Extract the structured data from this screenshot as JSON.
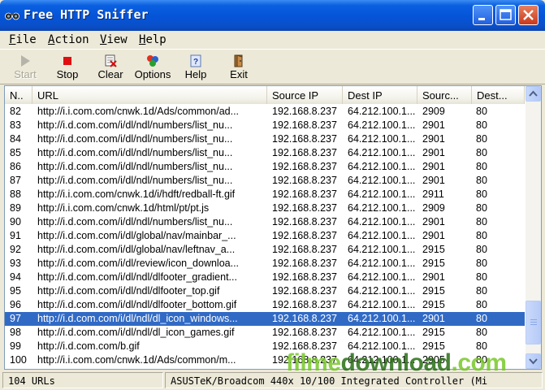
{
  "window": {
    "title": "Free HTTP Sniffer"
  },
  "menu": [
    {
      "accel": "F",
      "rest": "ile"
    },
    {
      "accel": "A",
      "rest": "ction"
    },
    {
      "accel": "V",
      "rest": "iew"
    },
    {
      "accel": "H",
      "rest": "elp"
    }
  ],
  "toolbar": {
    "start": "Start",
    "stop": "Stop",
    "clear": "Clear",
    "options": "Options",
    "help": "Help",
    "exit": "Exit"
  },
  "columns": [
    "N..",
    "URL",
    "Source IP",
    "Dest IP",
    "Sourc...",
    "Dest..."
  ],
  "rows": [
    [
      "82",
      "http://i.i.com.com/cnwk.1d/Ads/common/ad...",
      "192.168.8.237",
      "64.212.100.1...",
      "2909",
      "80"
    ],
    [
      "83",
      "http://i.d.com.com/i/dl/ndl/numbers/list_nu...",
      "192.168.8.237",
      "64.212.100.1...",
      "2901",
      "80"
    ],
    [
      "84",
      "http://i.d.com.com/i/dl/ndl/numbers/list_nu...",
      "192.168.8.237",
      "64.212.100.1...",
      "2901",
      "80"
    ],
    [
      "85",
      "http://i.d.com.com/i/dl/ndl/numbers/list_nu...",
      "192.168.8.237",
      "64.212.100.1...",
      "2901",
      "80"
    ],
    [
      "86",
      "http://i.d.com.com/i/dl/ndl/numbers/list_nu...",
      "192.168.8.237",
      "64.212.100.1...",
      "2901",
      "80"
    ],
    [
      "87",
      "http://i.d.com.com/i/dl/ndl/numbers/list_nu...",
      "192.168.8.237",
      "64.212.100.1...",
      "2901",
      "80"
    ],
    [
      "88",
      "http://i.i.com.com/cnwk.1d/i/hdft/redball-ft.gif",
      "192.168.8.237",
      "64.212.100.1...",
      "2911",
      "80"
    ],
    [
      "89",
      "http://i.i.com.com/cnwk.1d/html/pt/pt.js",
      "192.168.8.237",
      "64.212.100.1...",
      "2909",
      "80"
    ],
    [
      "90",
      "http://i.d.com.com/i/dl/ndl/numbers/list_nu...",
      "192.168.8.237",
      "64.212.100.1...",
      "2901",
      "80"
    ],
    [
      "91",
      "http://i.d.com.com/i/dl/global/nav/mainbar_...",
      "192.168.8.237",
      "64.212.100.1...",
      "2901",
      "80"
    ],
    [
      "92",
      "http://i.d.com.com/i/dl/global/nav/leftnav_a...",
      "192.168.8.237",
      "64.212.100.1...",
      "2915",
      "80"
    ],
    [
      "93",
      "http://i.d.com.com/i/dl/review/icon_downloa...",
      "192.168.8.237",
      "64.212.100.1...",
      "2915",
      "80"
    ],
    [
      "94",
      "http://i.d.com.com/i/dl/ndl/dlfooter_gradient...",
      "192.168.8.237",
      "64.212.100.1...",
      "2901",
      "80"
    ],
    [
      "95",
      "http://i.d.com.com/i/dl/ndl/dlfooter_top.gif",
      "192.168.8.237",
      "64.212.100.1...",
      "2915",
      "80"
    ],
    [
      "96",
      "http://i.d.com.com/i/dl/ndl/dlfooter_bottom.gif",
      "192.168.8.237",
      "64.212.100.1...",
      "2915",
      "80"
    ],
    [
      "97",
      "http://i.d.com.com/i/dl/ndl/dl_icon_windows...",
      "192.168.8.237",
      "64.212.100.1...",
      "2901",
      "80"
    ],
    [
      "98",
      "http://i.d.com.com/i/dl/ndl/dl_icon_games.gif",
      "192.168.8.237",
      "64.212.100.1...",
      "2915",
      "80"
    ],
    [
      "99",
      "http://i.d.com.com/b.gif",
      "192.168.8.237",
      "64.212.100.1...",
      "2915",
      "80"
    ],
    [
      "100",
      "http://i.i.com.com/cnwk.1d/Ads/common/m...",
      "192.168.8.237",
      "64.212.100.1...",
      "2905",
      "80"
    ]
  ],
  "selected_row": "97",
  "status": {
    "count": "104 URLs",
    "adapter": "ASUSTeK/Broadcom 440x 10/100 Integrated Controller (Mi"
  },
  "watermark": {
    "part1": "filme",
    "part2": "download",
    "part3": ".com"
  },
  "colors": {
    "selection": "#316ac5",
    "titlebar": "#0554d8",
    "close_button": "#c8391b"
  },
  "icons": {
    "app": "binoculars-icon",
    "start": "play-icon",
    "stop": "stop-square-icon",
    "clear": "clear-icon",
    "options": "options-icon",
    "help": "help-icon",
    "exit": "exit-door-icon"
  }
}
